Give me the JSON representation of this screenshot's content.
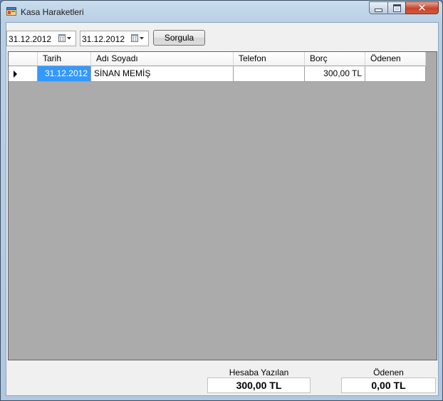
{
  "window": {
    "title": "Kasa Haraketleri",
    "close_glyph": "✕"
  },
  "filters": {
    "start_date": "31.12.2012",
    "end_date": "31.12.2012",
    "query_button": "Sorgula"
  },
  "table": {
    "columns": [
      "Tarih",
      "Adı Soyadı",
      "Telefon",
      "Borç",
      "Ödenen"
    ],
    "rows": [
      {
        "tarih": "31.12.2012",
        "adi_soyadi": "SİNAN MEMİŞ",
        "telefon": "",
        "borc": "300,00 TL",
        "odenen": ""
      }
    ]
  },
  "totals": {
    "hesaba_yazilan_label": "Hesaba Yazılan",
    "hesaba_yazilan_value": "300,00 TL",
    "odenen_label": "Ödenen",
    "odenen_value": "0,00 TL"
  },
  "colors": {
    "selected_cell": "#3399ff",
    "grid_background": "#ababab",
    "close_button": "#c6452c"
  },
  "icons": {
    "app": "form-icon",
    "calendar": "calendar-icon",
    "row_indicator": "row-pointer-icon"
  }
}
